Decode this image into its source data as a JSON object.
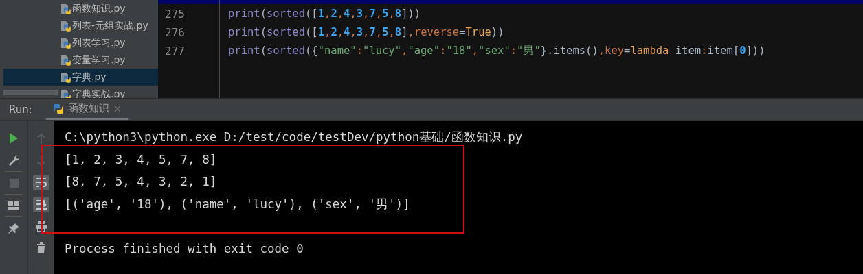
{
  "project_tree": {
    "items": [
      {
        "label": "函数知识.py",
        "selected": false
      },
      {
        "label": "列表-元组实战.py",
        "selected": false
      },
      {
        "label": "列表学习.py",
        "selected": false
      },
      {
        "label": "变量学习.py",
        "selected": false
      },
      {
        "label": "字典.py",
        "selected": true
      },
      {
        "label": "字典实战.py",
        "selected": false
      }
    ]
  },
  "editor": {
    "lines": [
      {
        "number": "275",
        "tokens": [
          {
            "kind": "func",
            "text": "print"
          },
          {
            "kind": "punct",
            "text": "("
          },
          {
            "kind": "func",
            "text": "sorted"
          },
          {
            "kind": "punct",
            "text": "(["
          },
          {
            "kind": "num",
            "text": "1"
          },
          {
            "kind": "op",
            "text": ","
          },
          {
            "kind": "num",
            "text": "2"
          },
          {
            "kind": "op",
            "text": ","
          },
          {
            "kind": "num",
            "text": "4"
          },
          {
            "kind": "op",
            "text": ","
          },
          {
            "kind": "num",
            "text": "3"
          },
          {
            "kind": "op",
            "text": ","
          },
          {
            "kind": "num",
            "text": "7"
          },
          {
            "kind": "op",
            "text": ","
          },
          {
            "kind": "num",
            "text": "5"
          },
          {
            "kind": "op",
            "text": ","
          },
          {
            "kind": "num",
            "text": "8"
          },
          {
            "kind": "punct",
            "text": "]))"
          }
        ]
      },
      {
        "number": "276",
        "tokens": [
          {
            "kind": "func",
            "text": "print"
          },
          {
            "kind": "punct",
            "text": "("
          },
          {
            "kind": "func",
            "text": "sorted"
          },
          {
            "kind": "punct",
            "text": "(["
          },
          {
            "kind": "num",
            "text": "1"
          },
          {
            "kind": "op",
            "text": ","
          },
          {
            "kind": "num",
            "text": "2"
          },
          {
            "kind": "op",
            "text": ","
          },
          {
            "kind": "num",
            "text": "4"
          },
          {
            "kind": "op",
            "text": ","
          },
          {
            "kind": "num",
            "text": "3"
          },
          {
            "kind": "op",
            "text": ","
          },
          {
            "kind": "num",
            "text": "7"
          },
          {
            "kind": "op",
            "text": ","
          },
          {
            "kind": "num",
            "text": "5"
          },
          {
            "kind": "op",
            "text": ","
          },
          {
            "kind": "num",
            "text": "8"
          },
          {
            "kind": "punct",
            "text": "]"
          },
          {
            "kind": "op",
            "text": ","
          },
          {
            "kind": "param",
            "text": "reverse"
          },
          {
            "kind": "punct",
            "text": "="
          },
          {
            "kind": "kw",
            "text": "True"
          },
          {
            "kind": "punct",
            "text": "))"
          }
        ]
      },
      {
        "number": "277",
        "tokens": [
          {
            "kind": "func",
            "text": "print"
          },
          {
            "kind": "punct",
            "text": "("
          },
          {
            "kind": "func",
            "text": "sorted"
          },
          {
            "kind": "punct",
            "text": "({"
          },
          {
            "kind": "str",
            "text": "\"name\""
          },
          {
            "kind": "op",
            "text": ":"
          },
          {
            "kind": "str",
            "text": "\"lucy\""
          },
          {
            "kind": "op",
            "text": ","
          },
          {
            "kind": "str",
            "text": "\"age\""
          },
          {
            "kind": "op",
            "text": ":"
          },
          {
            "kind": "str",
            "text": "\"18\""
          },
          {
            "kind": "op",
            "text": ","
          },
          {
            "kind": "str",
            "text": "\"sex\""
          },
          {
            "kind": "op",
            "text": ":"
          },
          {
            "kind": "str",
            "text": "\"男\""
          },
          {
            "kind": "punct",
            "text": "}.items()"
          },
          {
            "kind": "op",
            "text": ","
          },
          {
            "kind": "param",
            "text": "key"
          },
          {
            "kind": "punct",
            "text": "="
          },
          {
            "kind": "kw",
            "text": "lambda"
          },
          {
            "kind": "punct",
            "text": " item"
          },
          {
            "kind": "op",
            "text": ":"
          },
          {
            "kind": "punct",
            "text": "item["
          },
          {
            "kind": "num",
            "text": "0"
          },
          {
            "kind": "punct",
            "text": "]))"
          }
        ]
      }
    ]
  },
  "run_panel": {
    "label": "Run:",
    "tabs": [
      {
        "label": "函数知识",
        "selected": true,
        "close": "×"
      }
    ],
    "left_toolbar": [
      {
        "kind": "run"
      },
      {
        "kind": "wrench"
      },
      {
        "kind": "stop"
      },
      {
        "kind": "layout"
      },
      {
        "kind": "pin"
      }
    ],
    "right_toolbar": [
      {
        "kind": "up",
        "disabled": true
      },
      {
        "kind": "down",
        "disabled": true
      },
      {
        "kind": "wrap",
        "on": true
      },
      {
        "kind": "scroll",
        "on": true
      },
      {
        "kind": "print",
        "disabled": false
      },
      {
        "kind": "trash",
        "disabled": false
      }
    ],
    "console": {
      "command": "C:\\python3\\python.exe D:/test/code/testDev/python基础/函数知识.py",
      "lines": [
        "[1, 2, 3, 4, 5, 7, 8]",
        "[8, 7, 5, 4, 3, 2, 1]",
        "[('age', '18'), ('name', 'lucy'), ('sex', '男')]"
      ],
      "exit_message": "Process finished with exit code 0"
    }
  }
}
